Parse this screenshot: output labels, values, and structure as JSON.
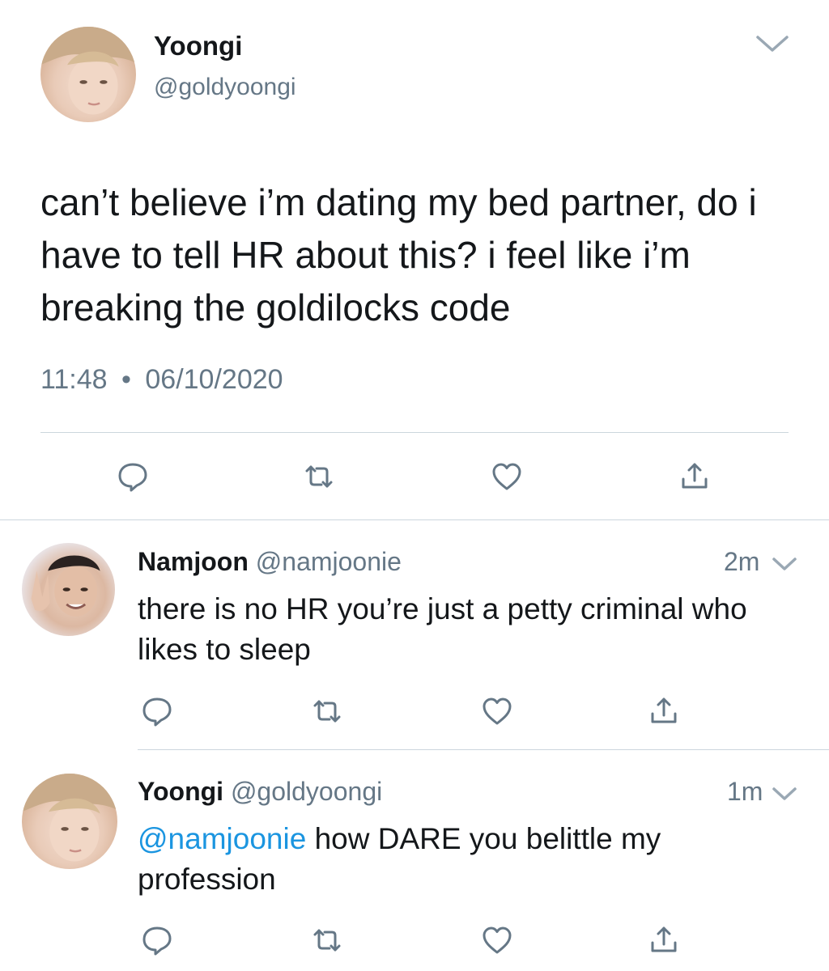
{
  "main_tweet": {
    "display_name": "Yoongi",
    "handle": "@goldyoongi",
    "text": "can’t believe i’m dating my bed partner, do i have to tell HR about this? i feel like i’m breaking the goldilocks code",
    "time": "11:48",
    "separator": "•",
    "date": "06/10/2020"
  },
  "replies": [
    {
      "display_name": "Namjoon",
      "handle": "@namjoonie",
      "age": "2m",
      "mention": "",
      "text": "there is no HR you’re just a petty criminal who likes to sleep"
    },
    {
      "display_name": "Yoongi",
      "handle": "@goldyoongi",
      "age": "1m",
      "mention": "@namjoonie",
      "text": " how DARE you belittle my profession"
    }
  ],
  "icons": {
    "reply": "reply-icon",
    "retweet": "retweet-icon",
    "like": "heart-icon",
    "share": "share-icon",
    "more": "chevron-down-icon"
  },
  "colors": {
    "text": "#14171a",
    "muted": "#657786",
    "link": "#1b95e0",
    "divider": "#ccd6dd"
  }
}
